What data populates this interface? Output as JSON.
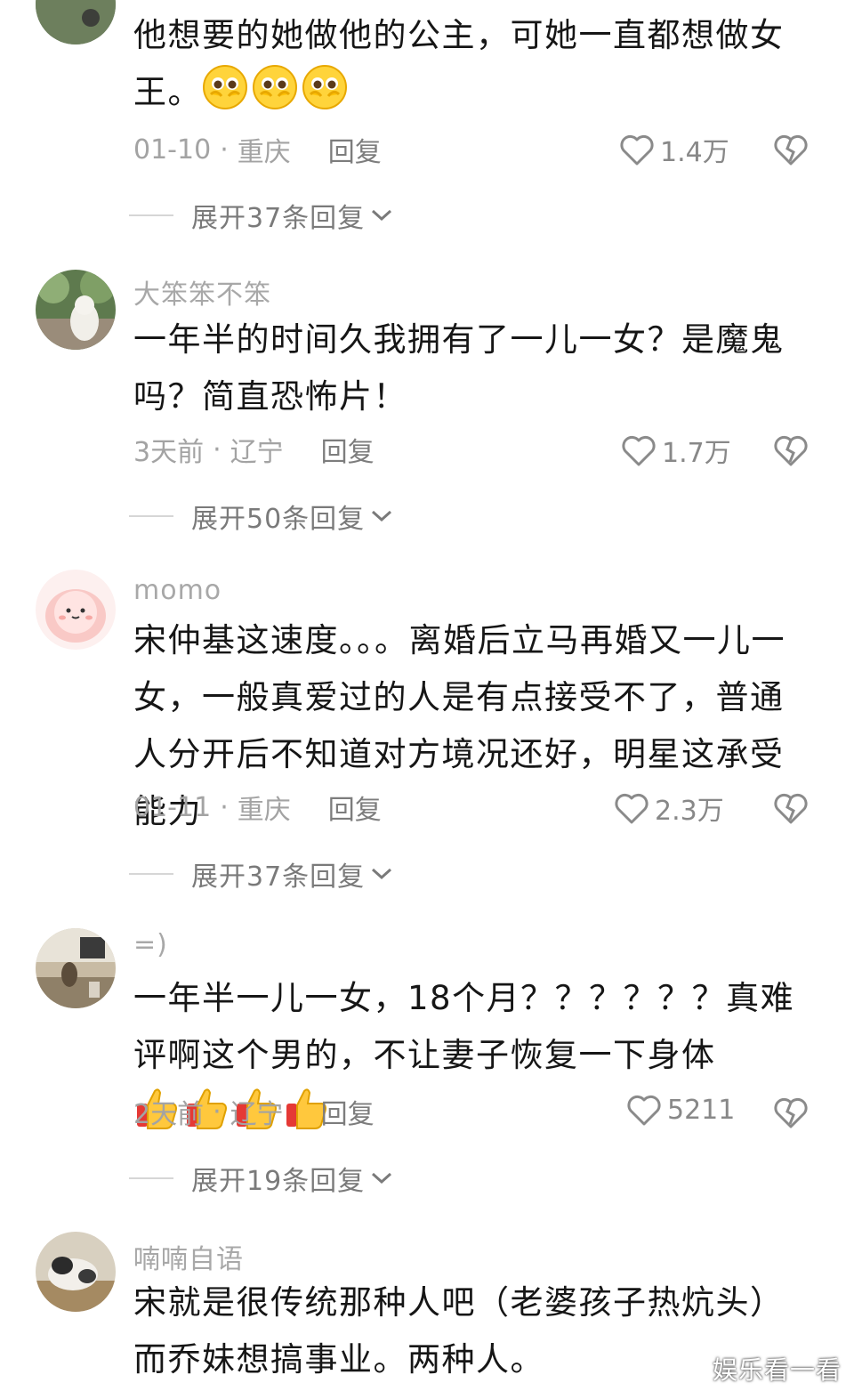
{
  "comments": [
    {
      "username": "",
      "text": "他想要的她做他的公主，可她一直都想做女王。",
      "time": "01-10",
      "location": "重庆",
      "reply_label": "回复",
      "likes": "1.4万",
      "expand_label": "展开37条回复",
      "avatar": "landscape-photo"
    },
    {
      "username": "大笨笨不笨",
      "text": "一年半的时间久我拥有了一儿一女？是魔鬼吗？简直恐怖片！",
      "time": "3天前",
      "location": "辽宁",
      "reply_label": "回复",
      "likes": "1.7万",
      "expand_label": "展开50条回复",
      "avatar": "dog-photo"
    },
    {
      "username": "momo",
      "text": "宋仲基这速度。。。离婚后立马再婚又一儿一女，一般真爱过的人是有点接受不了，普通人分开后不知道对方境况还好，明星这承受能力",
      "time": "01-11",
      "location": "重庆",
      "reply_label": "回复",
      "likes": "2.3万",
      "expand_label": "展开37条回复",
      "avatar": "pink-cartoon"
    },
    {
      "username": "=)",
      "text": "一年半一儿一女，18个月？？？？？？真难评啊这个男的，不让妻子恢复一下身体",
      "time": "2天前",
      "location": "辽宁",
      "reply_label": "回复",
      "likes": "5211",
      "expand_label": "展开19条回复",
      "avatar": "room-photo"
    },
    {
      "username": "喃喃自语",
      "text": "宋就是很传统那种人吧（老婆孩子热炕头）而乔妹想搞事业。两种人。",
      "avatar": "cat-photo"
    }
  ],
  "icons": {
    "like": "heart-outline-icon",
    "dislike": "broken-heart-icon",
    "expand": "chevron-down-icon",
    "emoji_1": "pleading-face-emoji",
    "emoji_2": "thumbs-up-emoji"
  },
  "watermark": "娱乐看一看",
  "colors": {
    "meta_gray": "#a3a3a3",
    "text": "#161616",
    "divider": "#d6d6d6"
  }
}
